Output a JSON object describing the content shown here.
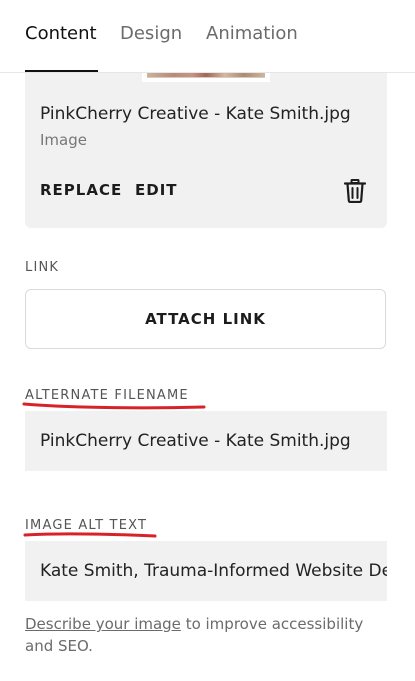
{
  "tabs": {
    "content": "Content",
    "design": "Design",
    "animation": "Animation",
    "active": "content"
  },
  "image": {
    "file_name": "PinkCherry Creative - Kate Smith.jpg",
    "file_type": "Image",
    "replace_label": "REPLACE",
    "edit_label": "EDIT",
    "delete_icon": "trash-icon"
  },
  "link": {
    "section_label": "LINK",
    "attach_label": "ATTACH LINK"
  },
  "alternate_filename": {
    "section_label": "ALTERNATE FILENAME",
    "value": "PinkCherry Creative - Kate Smith.jpg"
  },
  "image_alt_text": {
    "section_label": "IMAGE ALT TEXT",
    "value": "Kate Smith, Trauma-Informed Website Designer"
  },
  "help": {
    "link_text": "Describe your image",
    "rest_text": " to improve accessibility and SEO."
  },
  "colors": {
    "annotation_red": "#d8222a",
    "field_background": "#f1f1f1",
    "text_primary": "#1c1c1c",
    "text_muted": "#6b6b6b"
  }
}
